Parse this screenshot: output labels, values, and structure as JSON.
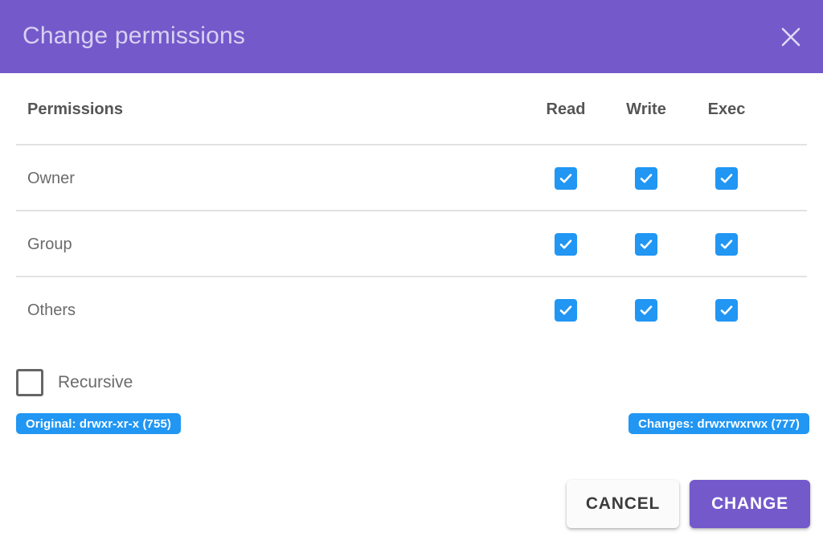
{
  "dialog": {
    "title": "Change permissions",
    "close_icon": "close-icon",
    "accent_purple": "#7459CB",
    "accent_blue": "#2196F3"
  },
  "table": {
    "headers": {
      "label": "Permissions",
      "read": "Read",
      "write": "Write",
      "exec": "Exec"
    },
    "rows": [
      {
        "label": "Owner",
        "read": true,
        "write": true,
        "exec": true
      },
      {
        "label": "Group",
        "read": true,
        "write": true,
        "exec": true
      },
      {
        "label": "Others",
        "read": true,
        "write": true,
        "exec": true
      }
    ]
  },
  "recursive": {
    "label": "Recursive",
    "checked": false
  },
  "badges": {
    "original": "Original: drwxr-xr-x (755)",
    "changes": "Changes: drwxrwxrwx (777)"
  },
  "footer": {
    "cancel_label": "CANCEL",
    "change_label": "CHANGE"
  }
}
